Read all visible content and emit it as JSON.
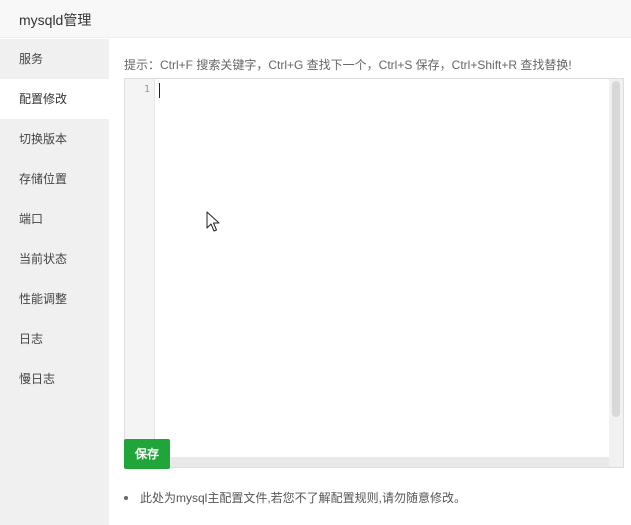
{
  "window": {
    "title": "mysqld管理"
  },
  "sidebar": {
    "items": [
      {
        "label": "服务",
        "active": false
      },
      {
        "label": "配置修改",
        "active": true
      },
      {
        "label": "切换版本",
        "active": false
      },
      {
        "label": "存储位置",
        "active": false
      },
      {
        "label": "端口",
        "active": false
      },
      {
        "label": "当前状态",
        "active": false
      },
      {
        "label": "性能调整",
        "active": false
      },
      {
        "label": "日志",
        "active": false
      },
      {
        "label": "慢日志",
        "active": false
      }
    ]
  },
  "main": {
    "hint": "提示：Ctrl+F 搜索关键字，Ctrl+G 查找下一个，Ctrl+S 保存，Ctrl+Shift+R 查找替换!",
    "editor": {
      "line_numbers": [
        "1"
      ],
      "content": ""
    },
    "save_label": "保存",
    "notes": [
      "此处为mysql主配置文件,若您不了解配置规则,请勿随意修改。"
    ]
  },
  "colors": {
    "accent": "#20a53a",
    "sidebar_bg": "#f0f0f0",
    "active_item_bg": "#ffffff"
  },
  "icons": {
    "mouse_pointer": "cursor-arrow-icon"
  }
}
